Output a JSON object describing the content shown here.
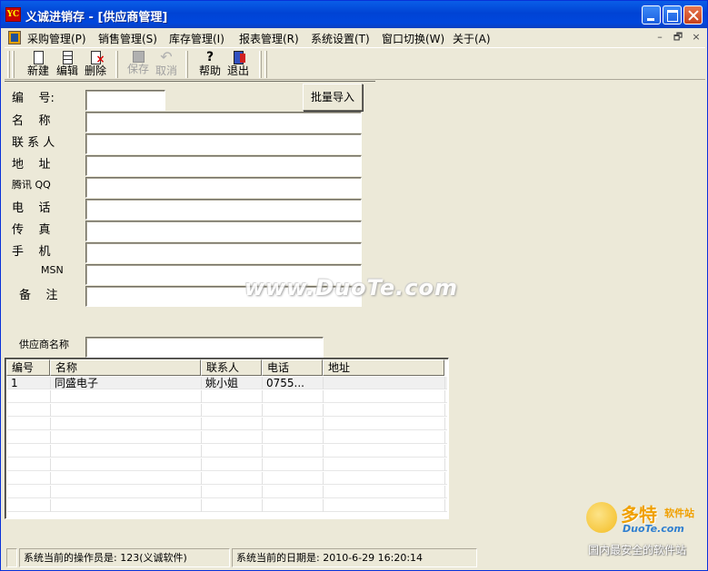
{
  "window": {
    "app_icon_text": "YC",
    "title": "义诚进销存 - [供应商管理]"
  },
  "menu": {
    "items": [
      "采购管理(P)",
      "销售管理(S)",
      "库存管理(I)",
      "报表管理(R)",
      "系统设置(T)",
      "窗口切换(W)",
      "关于(A)"
    ],
    "mdi_controls": [
      "–",
      "🗗",
      "×"
    ]
  },
  "toolbar": {
    "new_label": "新建",
    "edit_label": "编辑",
    "delete_label": "删除",
    "save_label": "保存",
    "cancel_label": "取消",
    "help_label": "帮助",
    "exit_label": "退出"
  },
  "form": {
    "labels": {
      "code": "编    号:",
      "name": "名    称",
      "contact": "联 系 人",
      "address": "地    址",
      "qq": "腾讯 QQ",
      "phone": "电    话",
      "fax": "传    真",
      "mobile": "手    机",
      "msn": "MSN",
      "remark": "备    注"
    },
    "values": {
      "code": "",
      "name": "",
      "contact": "",
      "address": "",
      "qq": "",
      "phone": "",
      "fax": "",
      "mobile": "",
      "msn": "",
      "remark": ""
    },
    "batch_import_label": "批量导入",
    "search_label": "供应商名称",
    "search_value": ""
  },
  "grid": {
    "columns": [
      "编号",
      "名称",
      "联系人",
      "电话",
      "地址"
    ],
    "rows": [
      [
        "1",
        "同盛电子",
        "姚小姐",
        "0755...",
        ""
      ]
    ]
  },
  "watermarks": {
    "main": "www.DuoTe.com",
    "logo_big": "多特",
    "logo_small": "软件站",
    "logo_site": "DuoTe.com",
    "logo_tagline": "国内最安全的软件站"
  },
  "status": {
    "operator": "系统当前的操作员是: 123(义诚软件)",
    "date": "系统当前的日期是: 2010-6-29 16:20:14"
  }
}
